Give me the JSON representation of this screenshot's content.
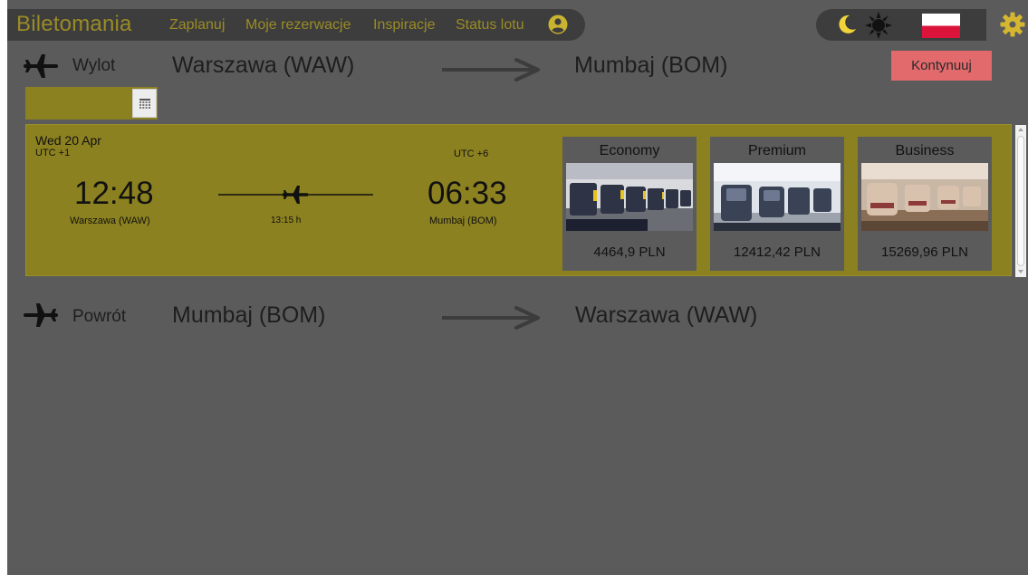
{
  "nav": {
    "brand": "Biletomania",
    "links": [
      "Zaplanuj",
      "Moje rezerwacje",
      "Inspiracje",
      "Status lotu"
    ]
  },
  "icons": {
    "user": "user-circle-icon",
    "moon": "moon-icon",
    "sun": "sun-icon",
    "flag": "poland-flag-icon",
    "settings": "gear-icon",
    "calendar": "calendar-icon"
  },
  "outbound": {
    "label": "Wylot",
    "from": "Warszawa (WAW)",
    "to": "Mumbaj (BOM)",
    "continue_label": "Kontynuuj"
  },
  "flight": {
    "date": "Wed 20 Apr",
    "utc_dep": "UTC +1",
    "utc_arr": "UTC +6",
    "dep_time": "12:48",
    "arr_time": "06:33",
    "dep_city": "Warszawa (WAW)",
    "arr_city": "Mumbaj (BOM)",
    "duration": "13:15 h",
    "classes": [
      {
        "name": "Economy",
        "price": "4464,9 PLN"
      },
      {
        "name": "Premium",
        "price": "12412,42 PLN"
      },
      {
        "name": "Business",
        "price": "15269,96 PLN"
      }
    ]
  },
  "return": {
    "label": "Powrót",
    "from": "Mumbaj (BOM)",
    "to": "Warszawa (WAW)"
  },
  "colors": {
    "background": "#5b5b5b",
    "navbar": "#3d3d3d",
    "accent": "#9a8b26",
    "card": "#8c8120",
    "button": "#e2696c"
  }
}
